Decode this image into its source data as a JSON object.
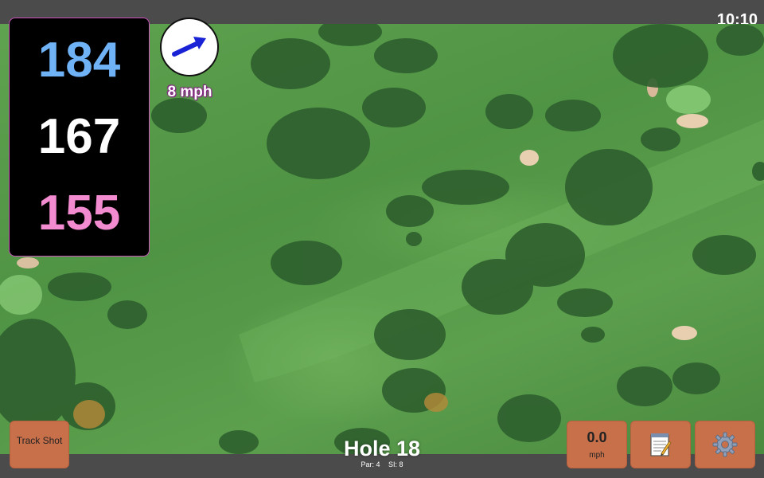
{
  "status_bar": {
    "time": "10:10"
  },
  "distances": {
    "back": "184",
    "middle": "167",
    "front": "155"
  },
  "wind": {
    "speed_label": "8 mph",
    "icon": "wind-arrow-icon",
    "arrow_color": "#1a22d6"
  },
  "buttons": {
    "track_shot_label": "Track Shot",
    "speed_value": "0.0",
    "speed_unit": "mph",
    "notes_icon": "notepad-icon",
    "settings_icon": "gear-icon"
  },
  "hole": {
    "title": "Hole 18",
    "par_label": "Par: 4",
    "si_label": "SI: 8"
  },
  "colors": {
    "back_distance": "#6fb2f5",
    "middle_distance": "#ffffff",
    "front_distance": "#f28bd0",
    "button_bg": "#c8704a",
    "panel_border": "#c850b8"
  }
}
